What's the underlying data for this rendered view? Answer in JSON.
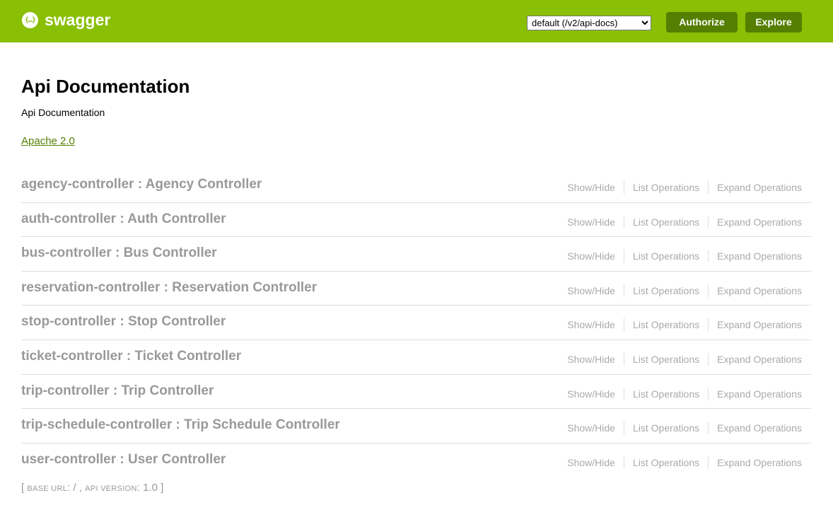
{
  "header": {
    "logo_icon_text": "{…}",
    "logo_text": "swagger",
    "spec_options": [
      "default (/v2/api-docs)"
    ],
    "spec_selected": "default (/v2/api-docs)",
    "authorize_label": "Authorize",
    "explore_label": "Explore",
    "brand_color": "#89bf04",
    "button_color": "#547f00"
  },
  "info": {
    "title": "Api Documentation",
    "description": "Api Documentation",
    "license": "Apache 2.0"
  },
  "resources": [
    {
      "name": "agency-controller : Agency Controller"
    },
    {
      "name": "auth-controller : Auth Controller"
    },
    {
      "name": "bus-controller : Bus Controller"
    },
    {
      "name": "reservation-controller : Reservation Controller"
    },
    {
      "name": "stop-controller : Stop Controller"
    },
    {
      "name": "ticket-controller : Ticket Controller"
    },
    {
      "name": "trip-controller : Trip Controller"
    },
    {
      "name": "trip-schedule-controller : Trip Schedule Controller"
    },
    {
      "name": "user-controller : User Controller"
    }
  ],
  "resource_ops": {
    "show_hide": "Show/Hide",
    "list_operations": "List Operations",
    "expand_operations": "Expand Operations"
  },
  "footer": {
    "open": "[ ",
    "base_url_label": "BASE URL",
    "base_url_value": ": / , ",
    "api_version_label": "API VERSION",
    "api_version_value": ": 1.0 ]"
  }
}
